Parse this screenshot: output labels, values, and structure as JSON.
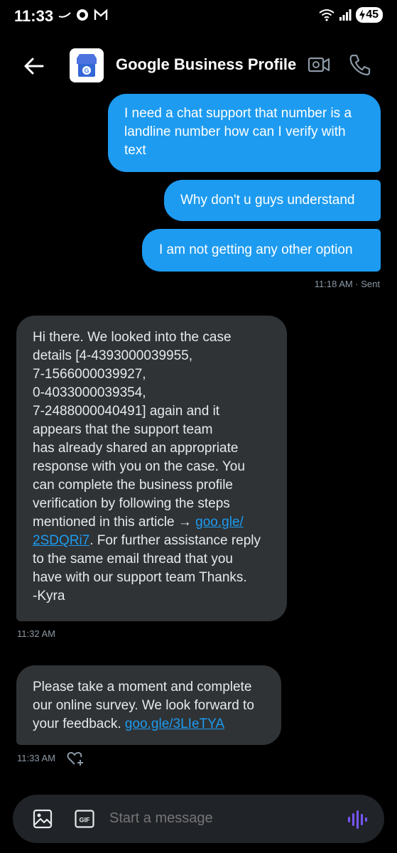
{
  "status_bar": {
    "time": "11:33",
    "battery": "45"
  },
  "header": {
    "title": "Google Business Profile",
    "avatar_letter": "G"
  },
  "messages": {
    "sent": [
      {
        "lines": [
          "I need a chat support that number is a",
          "landline number how can I verify with",
          "text"
        ]
      },
      {
        "lines": [
          "Why don't u guys understand"
        ]
      },
      {
        "lines": [
          "I am not getting any other option"
        ]
      }
    ],
    "sent_meta": "11:18 AM · Sent",
    "received_1": {
      "lines": [
        "Hi there. We looked into the case",
        "details [4-4393000039955,",
        "7-1566000039927,",
        "0-4033000039354,",
        "7-2488000040491] again and it",
        "appears that the support team",
        "has already shared an appropriate",
        "response with you on the case. You",
        "can complete the business profile",
        "verification by following the steps"
      ],
      "line_11_text": "mentioned in this article → ",
      "link_part_1": "goo.gle/",
      "link_part_2": "2SDQRi7",
      "line_12_rest": ". For further assistance reply",
      "tail_lines": [
        "to the same email thread that you",
        "have with our support team Thanks.",
        "-Kyra"
      ],
      "time": "11:32 AM"
    },
    "received_2": {
      "lines": [
        "Please take a moment and complete",
        "our online survey. We look forward to"
      ],
      "line_3_text": "your feedback. ",
      "link": "goo.gle/3LIeTYA",
      "time": "11:33 AM"
    }
  },
  "composer": {
    "placeholder": "Start a message",
    "gif_label": "GIF"
  },
  "colors": {
    "accent": "#1d9bf0",
    "background": "#000000",
    "received_bubble": "#2f3336",
    "muted": "#8b98a5"
  },
  "icons": [
    "back-arrow-icon",
    "video-call-icon",
    "phone-icon",
    "image-icon",
    "gif-icon",
    "voice-icon",
    "add-reaction-icon",
    "wifi-icon",
    "signal-icon",
    "battery-icon"
  ]
}
